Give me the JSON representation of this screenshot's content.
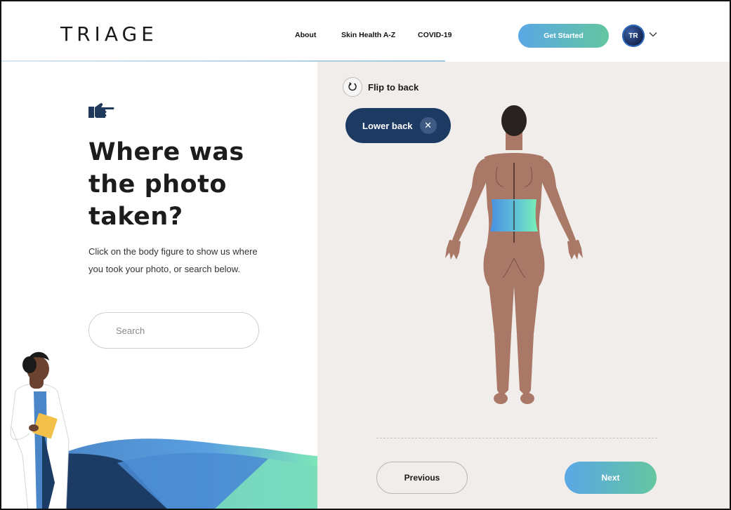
{
  "header": {
    "logo": "TRIAGE",
    "nav": [
      {
        "label": "About"
      },
      {
        "label": "Skin Health A-Z"
      },
      {
        "label": "COVID-19"
      }
    ],
    "cta_label": "Get Started",
    "avatar_initials": "TR",
    "avatar_menu_icon": "chevron-down-icon"
  },
  "left_panel": {
    "pointer_icon": "pointing-hand-icon",
    "title": "Where was the photo taken?",
    "description": "Click on the body figure to show us where you took your photo, or search below.",
    "search_placeholder": "Search"
  },
  "right_panel": {
    "flip_label": "Flip to back",
    "flip_icon": "rotate-icon",
    "selected_region": "Lower back",
    "remove_icon": "close-icon",
    "previous_label": "Previous",
    "next_label": "Next"
  },
  "colors": {
    "brand_gradient_start": "#5aa7e6",
    "brand_gradient_end": "#63c6a0",
    "chip_navy": "#1d3a63",
    "panel_bg": "#f0edea",
    "skin": "#a97866"
  }
}
